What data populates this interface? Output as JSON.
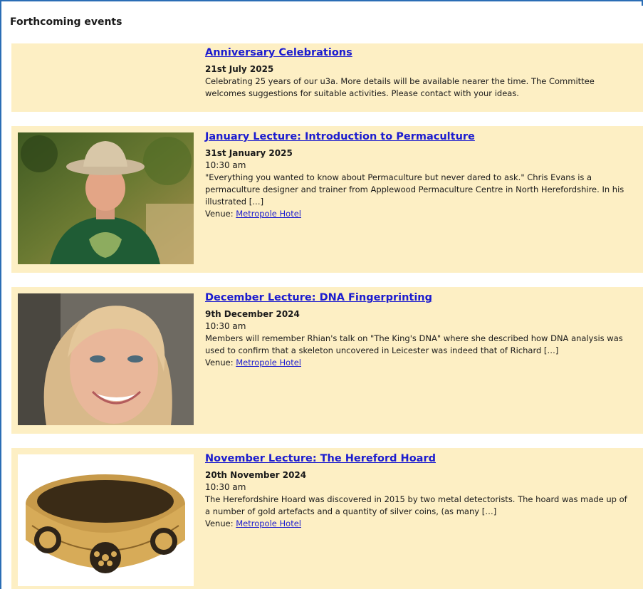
{
  "section_title": "Forthcoming events",
  "venue_label": "Venue:",
  "events": [
    {
      "title": "Anniversary Celebrations",
      "date": "21st July 2025",
      "description": "Celebrating 25 years of our u3a. More details will be available nearer the time. The Committee welcomes suggestions for suitable activities. Please contact with your ideas."
    },
    {
      "title": "January Lecture: Introduction to Permaculture",
      "date": "31st January 2025",
      "time": "10:30 am",
      "description": "\"Everything you wanted to know about Permaculture but never dared to ask.\" Chris Evans is a permaculture designer and trainer from Applewood Permaculture Centre in North Herefordshire. In his illustrated […]",
      "venue": "Metropole Hotel"
    },
    {
      "title": "December Lecture: DNA Fingerprinting",
      "date": "9th December 2024",
      "time": "10:30 am",
      "description": "Members will remember Rhian's talk on \"The King's DNA\" where she described how DNA analysis was used to confirm that a skeleton uncovered in Leicester was indeed that of Richard […]",
      "venue": "Metropole Hotel"
    },
    {
      "title": "November Lecture: The Hereford Hoard",
      "date": "20th November 2024",
      "time": "10:30 am",
      "description": "The Herefordshire Hoard was discovered in 2015 by two metal detectorists. The hoard was made up of a number of gold artefacts and a quantity of silver coins, (as many […]",
      "venue": "Metropole Hotel"
    }
  ]
}
